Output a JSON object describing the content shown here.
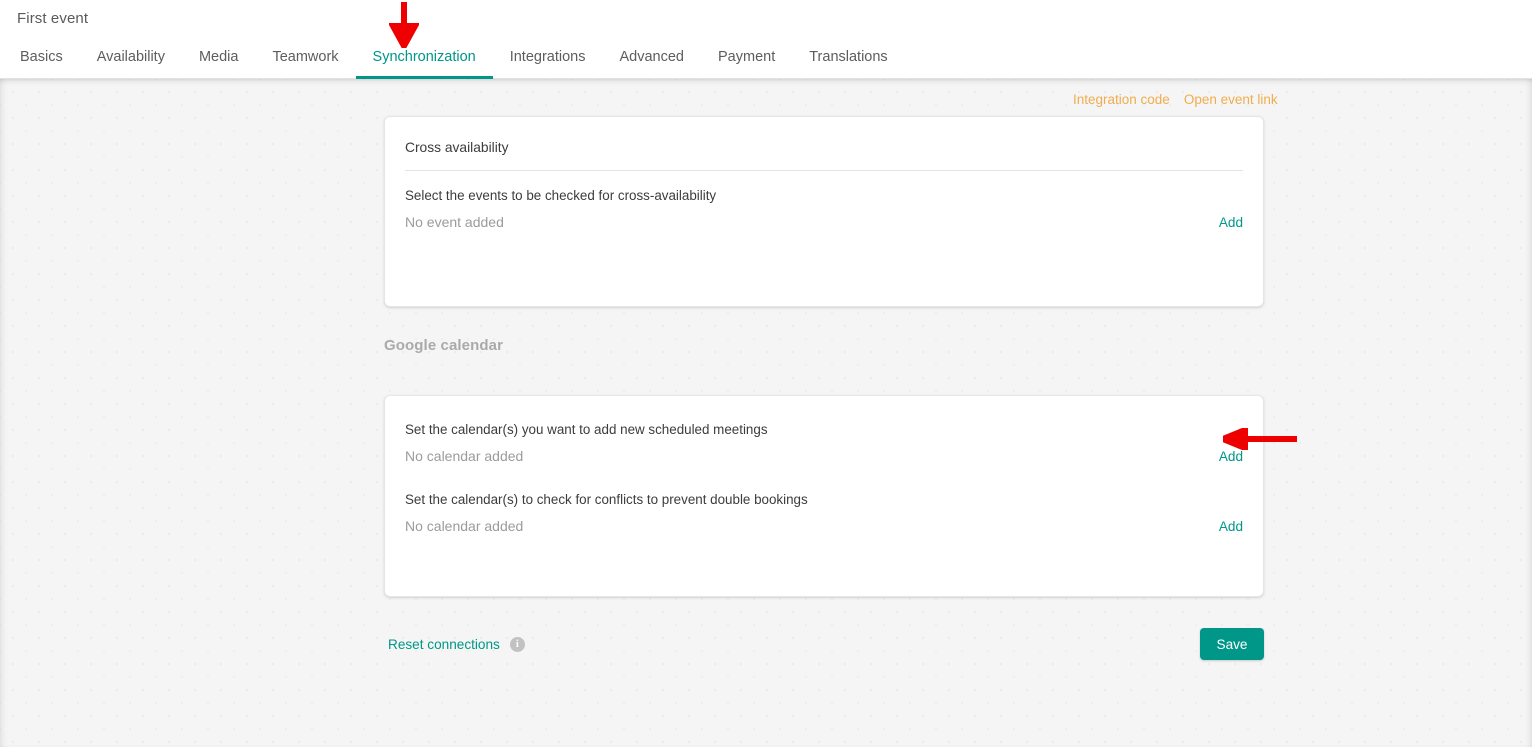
{
  "header": {
    "event_title": "First event",
    "tabs": [
      {
        "label": "Basics",
        "active": false
      },
      {
        "label": "Availability",
        "active": false
      },
      {
        "label": "Media",
        "active": false
      },
      {
        "label": "Teamwork",
        "active": false
      },
      {
        "label": "Synchronization",
        "active": true
      },
      {
        "label": "Integrations",
        "active": false
      },
      {
        "label": "Advanced",
        "active": false
      },
      {
        "label": "Payment",
        "active": false
      },
      {
        "label": "Translations",
        "active": false
      }
    ]
  },
  "top_links": {
    "integration_code": "Integration code",
    "open_event_link": "Open event link"
  },
  "cross_availability_card": {
    "title": "Cross availability",
    "field_label": "Select the events to be checked for cross-availability",
    "empty_value": "No event added",
    "add_label": "Add"
  },
  "google_calendar_section": {
    "heading": "Google calendar",
    "rows": [
      {
        "field_label": "Set the calendar(s) you want to add new scheduled meetings",
        "empty_value": "No calendar added",
        "add_label": "Add"
      },
      {
        "field_label": "Set the calendar(s) to check for conflicts to prevent double bookings",
        "empty_value": "No calendar added",
        "add_label": "Add"
      }
    ]
  },
  "footer": {
    "reset_label": "Reset connections",
    "info_icon_glyph": "i",
    "save_label": "Save"
  },
  "annotations": {
    "arrow_down_target": "Synchronization",
    "arrow_left_target": "Add"
  },
  "colors": {
    "accent_teal": "#009688",
    "link_orange": "#f0ad4e",
    "annotation_red": "#ee0000",
    "page_background": "#f5f5f5",
    "card_background": "#ffffff",
    "muted_text": "#9b9b9b",
    "heading_muted": "#aaaaaa"
  }
}
